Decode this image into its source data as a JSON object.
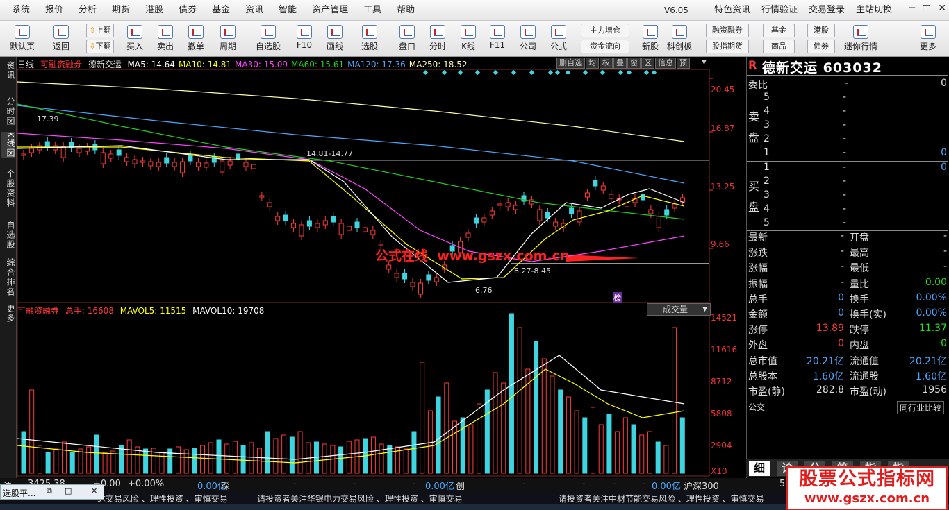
{
  "menu": {
    "items": [
      "系统",
      "报价",
      "分析",
      "期货",
      "港股",
      "债券",
      "基金",
      "资讯",
      "智能",
      "资产管理",
      "工具",
      "帮助"
    ],
    "version": "V6.05",
    "right_items": [
      "特色资讯",
      "行情验证",
      "交易登录",
      "主站切换"
    ]
  },
  "toolbar": {
    "buttons": [
      "默认页",
      "返回",
      "买入",
      "卖出",
      "撤单",
      "周期",
      "自选股",
      "F10",
      "画线",
      "选股",
      "盘口",
      "分时",
      "K线",
      "F11",
      "公司",
      "公式",
      "新股",
      "科创板",
      "迷你行情",
      "更多"
    ],
    "page_up": "上翻",
    "page_down": "下翻",
    "small": [
      "主力增仓",
      "资金流向",
      "融资融券",
      "股指期货",
      "基金",
      "商品",
      "港股",
      "债券"
    ]
  },
  "left_tabs": [
    "资讯",
    "分时图",
    "K线图",
    "个股资料",
    "自选股",
    "综合排名",
    "更多"
  ],
  "kline": {
    "period": "日线",
    "name_tag": "可融资融券",
    "stock_name": "德新交运",
    "ma": [
      {
        "label": "MA5: 14.64",
        "color": "#ffffff"
      },
      {
        "label": "MA10: 14.81",
        "color": "#ffff00"
      },
      {
        "label": "MA30: 15.09",
        "color": "#ff44ff"
      },
      {
        "label": "MA60: 15.61",
        "color": "#22cc22"
      },
      {
        "label": "MA120: 17.36",
        "color": "#4aa8ff"
      },
      {
        "label": "MA250: 18.52",
        "color": "#ffffaa"
      }
    ],
    "header_buttons": [
      "删自选",
      "均",
      "权",
      "叠",
      "窗",
      "区",
      "信息",
      "预"
    ],
    "y_labels": [
      "20.45",
      "16.87",
      "13.25",
      "9.66"
    ],
    "annotations": {
      "high": "17.39",
      "range1": "14.81-14.77",
      "range2": "8.27-8.45",
      "low": "6.76",
      "bang": "榜"
    },
    "overlay_text": "公式在线  www.gszx.com.cn"
  },
  "volume": {
    "name_tag": "可融资融券",
    "total_label": "总手: 16608",
    "mavol5": "MAVOL5: 11515",
    "mavol10": "MAVOL10: 19708",
    "dropdown": "成交量",
    "y_labels": [
      "14521",
      "11616",
      "8712",
      "5808",
      "2904",
      "X10"
    ]
  },
  "quote": {
    "logo": "R",
    "name": "德新交运",
    "code": "603032",
    "weibi_label": "委比",
    "weibi_value": "0",
    "sell_label": "卖盘",
    "buy_label": "买盘",
    "sell_levels": [
      {
        "n": "5",
        "p": "-",
        "v": ""
      },
      {
        "n": "4",
        "p": "-",
        "v": ""
      },
      {
        "n": "3",
        "p": "-",
        "v": ""
      },
      {
        "n": "2",
        "p": "-",
        "v": ""
      },
      {
        "n": "1",
        "p": "-",
        "v": "0"
      }
    ],
    "buy_levels": [
      {
        "n": "1",
        "p": "-",
        "v": "0"
      },
      {
        "n": "2",
        "p": "-",
        "v": ""
      },
      {
        "n": "3",
        "p": "-",
        "v": ""
      },
      {
        "n": "4",
        "p": "-",
        "v": ""
      },
      {
        "n": "5",
        "p": "-",
        "v": ""
      }
    ],
    "stats": [
      {
        "l1": "最新",
        "v1": "-",
        "l2": "开盘",
        "v2": "-",
        "c1": "#ddd",
        "c2": "#ddd"
      },
      {
        "l1": "涨跌",
        "v1": "-",
        "l2": "最高",
        "v2": "-",
        "c1": "#ddd",
        "c2": "#ddd"
      },
      {
        "l1": "涨幅",
        "v1": "-",
        "l2": "最低",
        "v2": "-",
        "c1": "#ddd",
        "c2": "#ddd"
      },
      {
        "l1": "振幅",
        "v1": "-",
        "l2": "量比",
        "v2": "0.00",
        "c1": "#ddd",
        "c2": "#22e022"
      },
      {
        "l1": "总手",
        "v1": "0",
        "l2": "换手",
        "v2": "0.00%",
        "c1": "#4aa8ff",
        "c2": "#4aa8ff"
      },
      {
        "l1": "金额",
        "v1": "0",
        "l2": "换手(实)",
        "v2": "0.00%",
        "c1": "#4aa8ff",
        "c2": "#4aa8ff"
      },
      {
        "l1": "涨停",
        "v1": "13.89",
        "l2": "跌停",
        "v2": "11.37",
        "c1": "#ff3b3b",
        "c2": "#22e022"
      },
      {
        "l1": "外盘",
        "v1": "0",
        "l2": "内盘",
        "v2": "0",
        "c1": "#ff3b3b",
        "c2": "#22e022"
      },
      {
        "l1": "总市值",
        "v1": "20.21亿",
        "l2": "流通值",
        "v2": "20.21亿",
        "c1": "#4aa8ff",
        "c2": "#4aa8ff"
      },
      {
        "l1": "总股本",
        "v1": "1.60亿",
        "l2": "流通股",
        "v2": "1.60亿",
        "c1": "#4aa8ff",
        "c2": "#4aa8ff"
      },
      {
        "l1": "市盈(静)",
        "v1": "282.8",
        "l2": "市盈(动)",
        "v2": "1956",
        "c1": "#ddd",
        "c2": "#ddd"
      }
    ],
    "industry": "公交",
    "industry_btn": "同行业比较",
    "tabs": [
      "细",
      "诊",
      "分",
      "筹",
      "指",
      "指"
    ]
  },
  "bottom_strip": {
    "items": [
      "沪",
      "3425.38",
      "+0.00",
      "+0.00%",
      "0.00亿",
      "深",
      "-",
      "-",
      "-",
      "-",
      "0.00亿",
      "创",
      "-",
      "-",
      "-",
      "-",
      "0.00亿",
      "沪深300",
      "50"
    ]
  },
  "ticker": {
    "left": "达交易风险 、理性投资 、审慎交易",
    "mid": "请投资者关注华银电力交易风险 、理性投资 、审慎交易",
    "right": "请投资者关注中材节能交易风险 、理性投资 、审慎交易"
  },
  "popup": {
    "title": "选股平..."
  },
  "watermark": {
    "line1": "股票公式指标网",
    "line2": "www.gszx.com.cn"
  }
}
